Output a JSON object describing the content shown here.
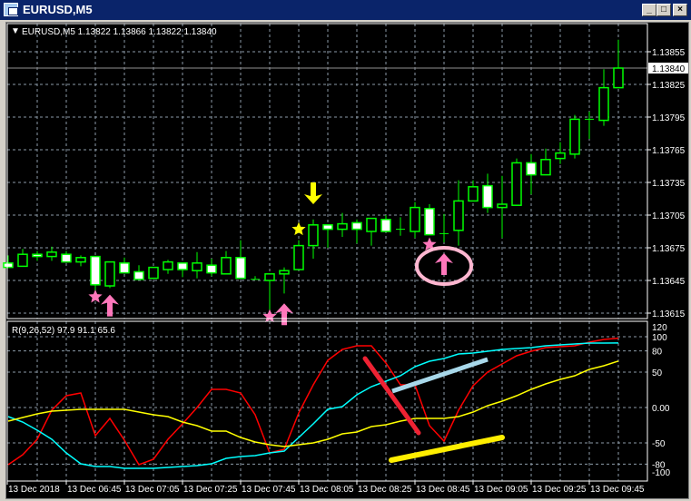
{
  "window": {
    "title": "EURUSD,M5",
    "buttons": {
      "minimize": "_",
      "maximize": "□",
      "close": "×"
    }
  },
  "main_panel": {
    "header": "EURUSD,M5  1.13822 1.13866 1.13822 1.13840",
    "price_ticks": [
      "1.13855",
      "1.13825",
      "1.13795",
      "1.13765",
      "1.13735",
      "1.13705",
      "1.13675",
      "1.13645",
      "1.13615"
    ],
    "current_price_label": "1.13840",
    "current_price": 1.1384
  },
  "indicator_panel": {
    "header": "R(9,26,52) 97.9 91.1 65.6",
    "ticks": [
      "120",
      "100",
      "80",
      "50",
      "0.00",
      "-50",
      "-80",
      "-100"
    ]
  },
  "time_axis": {
    "labels": [
      "13 Dec 2018",
      "13 Dec 06:45",
      "13 Dec 07:05",
      "13 Dec 07:25",
      "13 Dec 07:45",
      "13 Dec 08:05",
      "13 Dec 08:25",
      "13 Dec 08:45",
      "13 Dec 09:05",
      "13 Dec 09:25",
      "13 Dec 09:45"
    ]
  },
  "colors": {
    "titlebar": "#0a246a",
    "background": "#000000",
    "candle_outline": "#00ff00",
    "bear_fill": "#ffffff",
    "grid": "#8c9aa8",
    "red_line": "#ff0000",
    "cyan_line": "#00ffff",
    "yellow_line": "#ffff00",
    "pink_marker": "#ff77bb",
    "yellow_marker": "#ffff00"
  },
  "chart_data": [
    {
      "type": "candlestick",
      "symbol": "EURUSD",
      "timeframe": "M5",
      "ylim": [
        1.13605,
        1.1388
      ],
      "ohlc": [
        [
          1.13661,
          1.13668,
          1.13657,
          1.13657
        ],
        [
          1.13658,
          1.13674,
          1.13658,
          1.13669
        ],
        [
          1.13669,
          1.13672,
          1.13663,
          1.13667
        ],
        [
          1.13667,
          1.13676,
          1.13663,
          1.13671
        ],
        [
          1.13669,
          1.13672,
          1.13662,
          1.13662
        ],
        [
          1.13662,
          1.13668,
          1.13658,
          1.13666
        ],
        [
          1.13667,
          1.13667,
          1.13634,
          1.13641
        ],
        [
          1.1364,
          1.13662,
          1.13638,
          1.13662
        ],
        [
          1.13661,
          1.13666,
          1.13652,
          1.13652
        ],
        [
          1.13653,
          1.13659,
          1.13646,
          1.13646
        ],
        [
          1.13647,
          1.13657,
          1.13647,
          1.13657
        ],
        [
          1.13655,
          1.13664,
          1.13651,
          1.13662
        ],
        [
          1.13661,
          1.13661,
          1.13648,
          1.13655
        ],
        [
          1.13654,
          1.13671,
          1.13647,
          1.13661
        ],
        [
          1.13659,
          1.13665,
          1.13649,
          1.13652
        ],
        [
          1.13651,
          1.13672,
          1.13651,
          1.13666
        ],
        [
          1.13666,
          1.13682,
          1.13647,
          1.13647
        ],
        [
          1.13646,
          1.13649,
          1.13646,
          1.13646
        ],
        [
          1.13645,
          1.13651,
          1.13617,
          1.13651
        ],
        [
          1.13651,
          1.13657,
          1.13633,
          1.13654
        ],
        [
          1.13655,
          1.13682,
          1.13655,
          1.13677
        ],
        [
          1.13677,
          1.13701,
          1.13665,
          1.13696
        ],
        [
          1.13696,
          1.13696,
          1.13675,
          1.13692
        ],
        [
          1.13692,
          1.13707,
          1.13685,
          1.13697
        ],
        [
          1.13698,
          1.13701,
          1.13679,
          1.13692
        ],
        [
          1.1369,
          1.13702,
          1.13677,
          1.13702
        ],
        [
          1.13701,
          1.13705,
          1.1369,
          1.1369
        ],
        [
          1.13692,
          1.13703,
          1.13686,
          1.13692
        ],
        [
          1.1369,
          1.13717,
          1.13684,
          1.13712
        ],
        [
          1.13711,
          1.13715,
          1.13687,
          1.13687
        ],
        [
          1.13688,
          1.13706,
          1.1368,
          1.13688
        ],
        [
          1.13691,
          1.13737,
          1.13677,
          1.13718
        ],
        [
          1.13718,
          1.13737,
          1.13718,
          1.13731
        ],
        [
          1.13732,
          1.13743,
          1.13707,
          1.13712
        ],
        [
          1.13712,
          1.13741,
          1.13684,
          1.13715
        ],
        [
          1.13714,
          1.13757,
          1.13714,
          1.13753
        ],
        [
          1.13753,
          1.13761,
          1.13724,
          1.13742
        ],
        [
          1.13742,
          1.13766,
          1.13742,
          1.13756
        ],
        [
          1.13757,
          1.13772,
          1.13752,
          1.13762
        ],
        [
          1.13761,
          1.13797,
          1.13757,
          1.13793
        ],
        [
          1.13793,
          1.138,
          1.13775,
          1.13793
        ],
        [
          1.13792,
          1.13839,
          1.13787,
          1.13822
        ],
        [
          1.13822,
          1.13866,
          1.13822,
          1.1384
        ]
      ],
      "markers": [
        {
          "type": "star",
          "color": "pink",
          "candle": 6,
          "price": 1.1363
        },
        {
          "type": "arrow-up",
          "color": "pink",
          "candle": 7,
          "price": 1.13622
        },
        {
          "type": "star",
          "color": "pink",
          "candle": 18,
          "price": 1.13612
        },
        {
          "type": "arrow-up",
          "color": "pink",
          "candle": 19,
          "price": 1.13614
        },
        {
          "type": "star",
          "color": "yellow",
          "candle": 20,
          "price": 1.13692
        },
        {
          "type": "arrow-down",
          "color": "yellow",
          "candle": 21,
          "price": 1.13725
        },
        {
          "type": "star",
          "color": "pink",
          "candle": 29,
          "price": 1.13678
        },
        {
          "type": "arrow-up",
          "color": "pink",
          "candle": 30,
          "price": 1.1366,
          "circled": true
        }
      ]
    },
    {
      "type": "line",
      "ylim": [
        -110,
        125
      ],
      "levels": [
        100,
        80,
        50,
        0,
        -50,
        -80
      ],
      "series": [
        {
          "color": "red",
          "values": [
            -80.8,
            -66.7,
            -44.9,
            -3.8,
            16.7,
            20.5,
            -39.7,
            -15.4,
            -46.2,
            -80.8,
            -73.1,
            -44.9,
            -23.1,
            0,
            25.6,
            25.6,
            20.5,
            -10.3,
            -64.1,
            -59,
            -7.7,
            32,
            66.7,
            82,
            87.2,
            87.2,
            62.8,
            32,
            32,
            -25.6,
            -47.4,
            -3.8,
            30.8,
            50,
            61.5,
            73.1,
            79.5,
            84.6,
            85.9,
            87.2,
            92.3,
            96.2,
            97.9
          ]
        },
        {
          "color": "cyan",
          "values": [
            -12.8,
            -20.5,
            -32,
            -44.9,
            -64.1,
            -79.5,
            -83.3,
            -83.3,
            -85.9,
            -85.9,
            -85.9,
            -84.6,
            -83.3,
            -82,
            -79.5,
            -71.8,
            -69.2,
            -67.9,
            -64.1,
            -61.5,
            -42.3,
            -23.1,
            -2.6,
            1.3,
            17.9,
            29.5,
            37.2,
            44.9,
            57.7,
            65.4,
            69.2,
            75.6,
            76.9,
            79.5,
            82,
            83.3,
            84.6,
            87.2,
            88.5,
            89.7,
            91,
            91,
            91.1
          ]
        },
        {
          "color": "yellow",
          "values": [
            -19.2,
            -14.1,
            -9,
            -5.1,
            -3.8,
            -2.6,
            -2.6,
            -2.6,
            -2.6,
            -6.4,
            -10.3,
            -12.8,
            -20.5,
            -25.6,
            -33.3,
            -33.3,
            -42.3,
            -48.7,
            -52.6,
            -55.1,
            -52.6,
            -50,
            -44.9,
            -37.2,
            -34.6,
            -26.9,
            -24.4,
            -19.2,
            -15.4,
            -15.4,
            -15.4,
            -12.8,
            -6.4,
            2.6,
            9,
            16.7,
            25.6,
            33.3,
            39.7,
            44.9,
            53.8,
            59,
            65.6
          ]
        }
      ]
    }
  ]
}
